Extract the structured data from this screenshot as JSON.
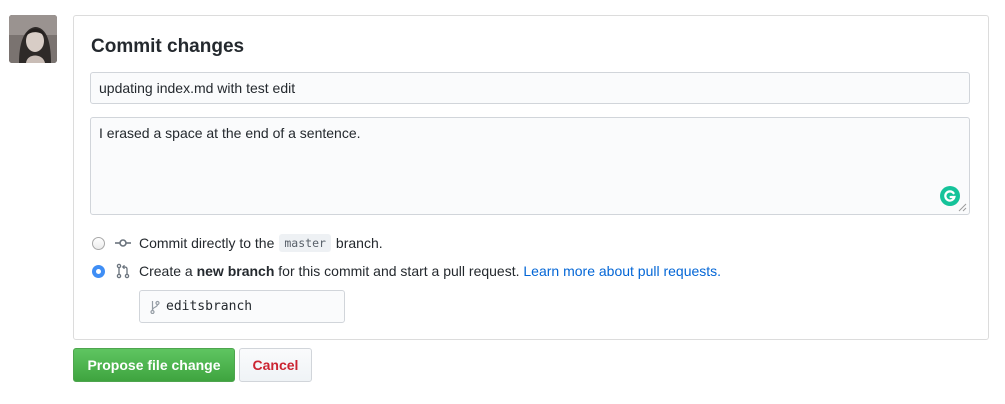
{
  "commit": {
    "title": "Commit changes",
    "summary_value": "updating index.md with test edit",
    "description_value": "I erased a space at the end of a sentence."
  },
  "options": {
    "direct": {
      "prefix": "Commit directly to the",
      "branch": "master",
      "suffix": "branch."
    },
    "new_branch": {
      "prefix": "Create a",
      "bold": "new branch",
      "suffix": "for this commit and start a pull request.",
      "link": "Learn more about pull requests."
    }
  },
  "branch_name_value": "editsbranch",
  "buttons": {
    "propose": "Propose file change",
    "cancel": "Cancel"
  },
  "icons": {
    "commit": "git-commit-icon",
    "pull_request": "git-pull-request-icon",
    "branch": "git-branch-icon",
    "grammarly": "grammarly-icon"
  },
  "colors": {
    "primary_button": "#4bb34b",
    "cancel_text": "#cb2431",
    "link": "#0366d6",
    "radio_checked": "#3f8ef5",
    "grammarly": "#15c39a"
  }
}
